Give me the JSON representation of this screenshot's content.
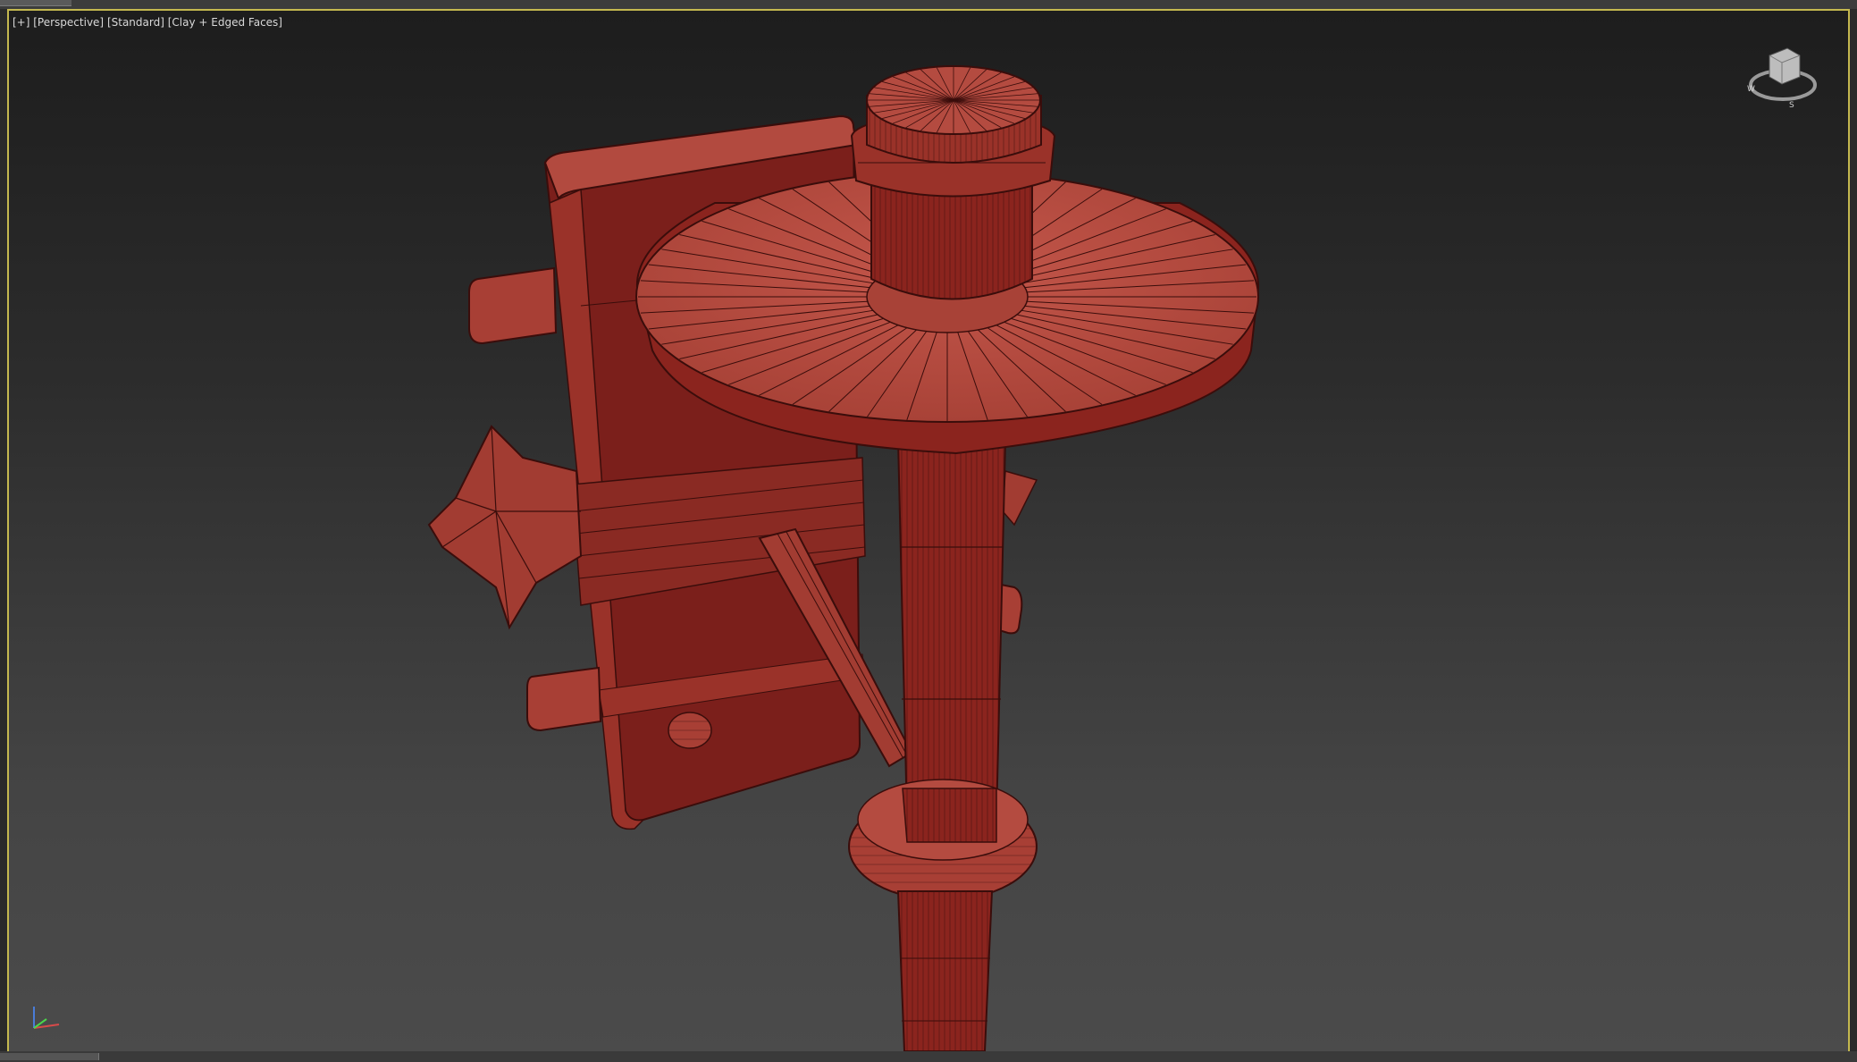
{
  "viewport": {
    "label_plus": "[+]",
    "label_view": "[Perspective]",
    "label_shading_preset": "[Standard]",
    "label_shading": "[Clay + Edged Faces]"
  },
  "viewcube": {
    "compass": {
      "west": "W",
      "south": "S"
    }
  },
  "colors": {
    "viewport_border": "#c4b84f",
    "clay": "#b24a3f",
    "clay_dark": "#7a1e1a",
    "wire": "#3a0d0b"
  },
  "icons": {
    "viewcube": "viewcube-icon",
    "axis_tripod": "axis-tripod-icon"
  }
}
